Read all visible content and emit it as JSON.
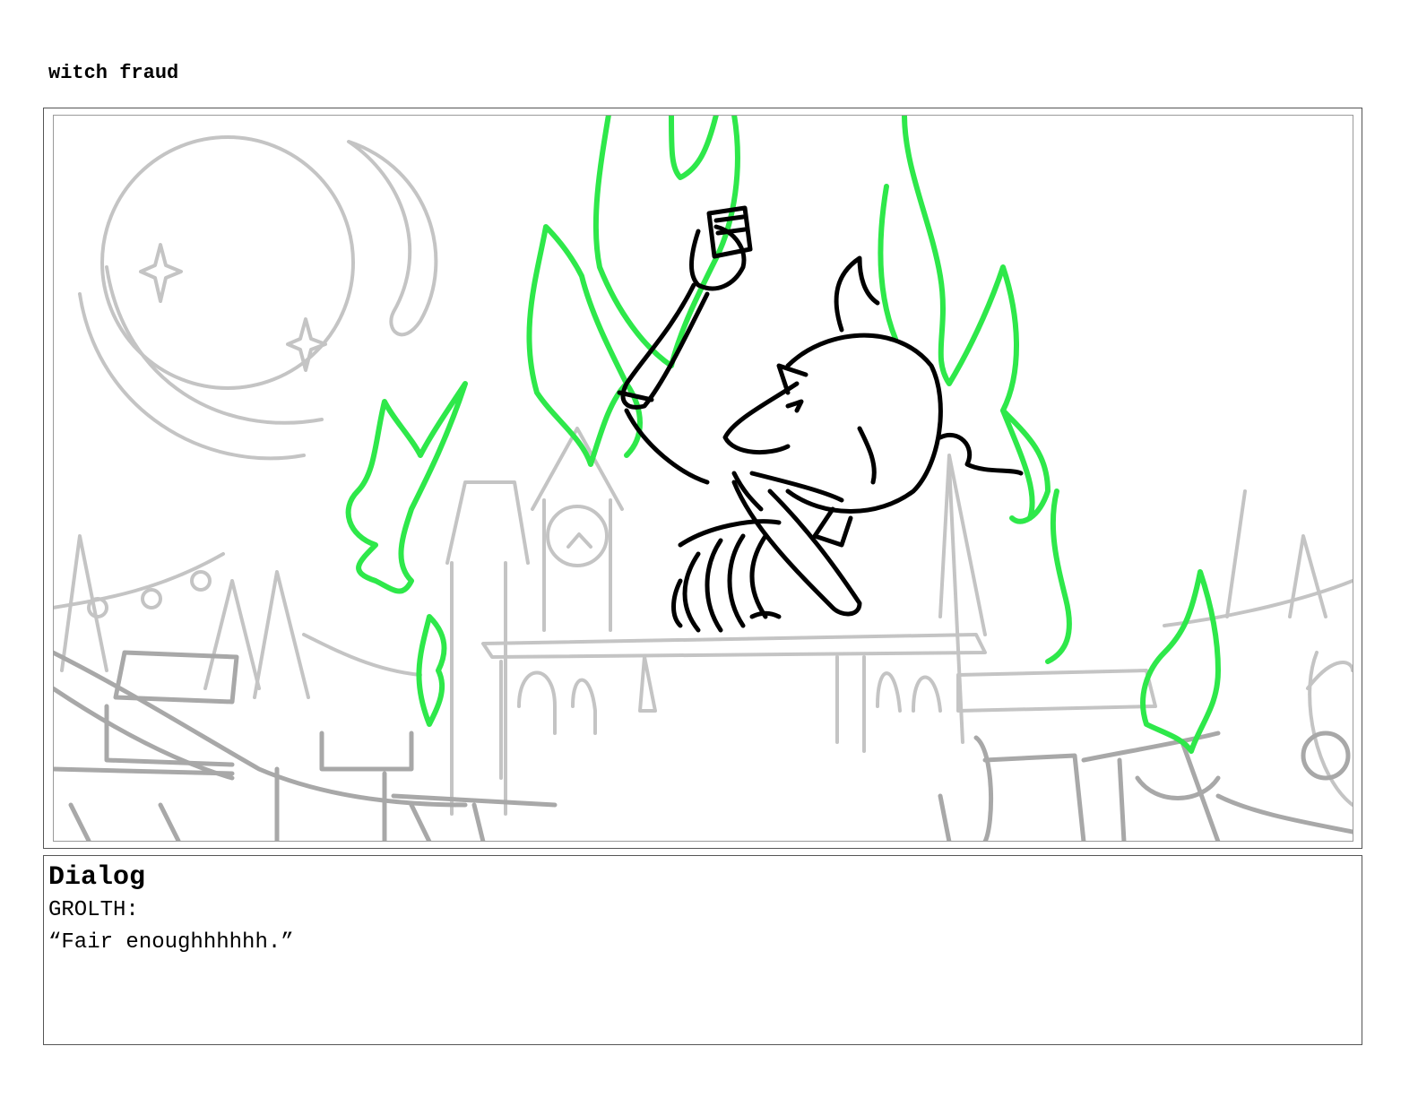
{
  "board": {
    "title": "witch fraud"
  },
  "panel": {
    "illustration": "sketch-skeleton-demon-holding-phone-in-green-flames",
    "colors": {
      "background_sketch": "#c4c4c4",
      "foreground_sketch": "#a8a8a8",
      "character_line": "#000000",
      "flames": "#2ee84a"
    }
  },
  "dialog": {
    "heading": "Dialog",
    "speaker": "GROLTH:",
    "line": "“Fair enoughhhhhh.”"
  }
}
